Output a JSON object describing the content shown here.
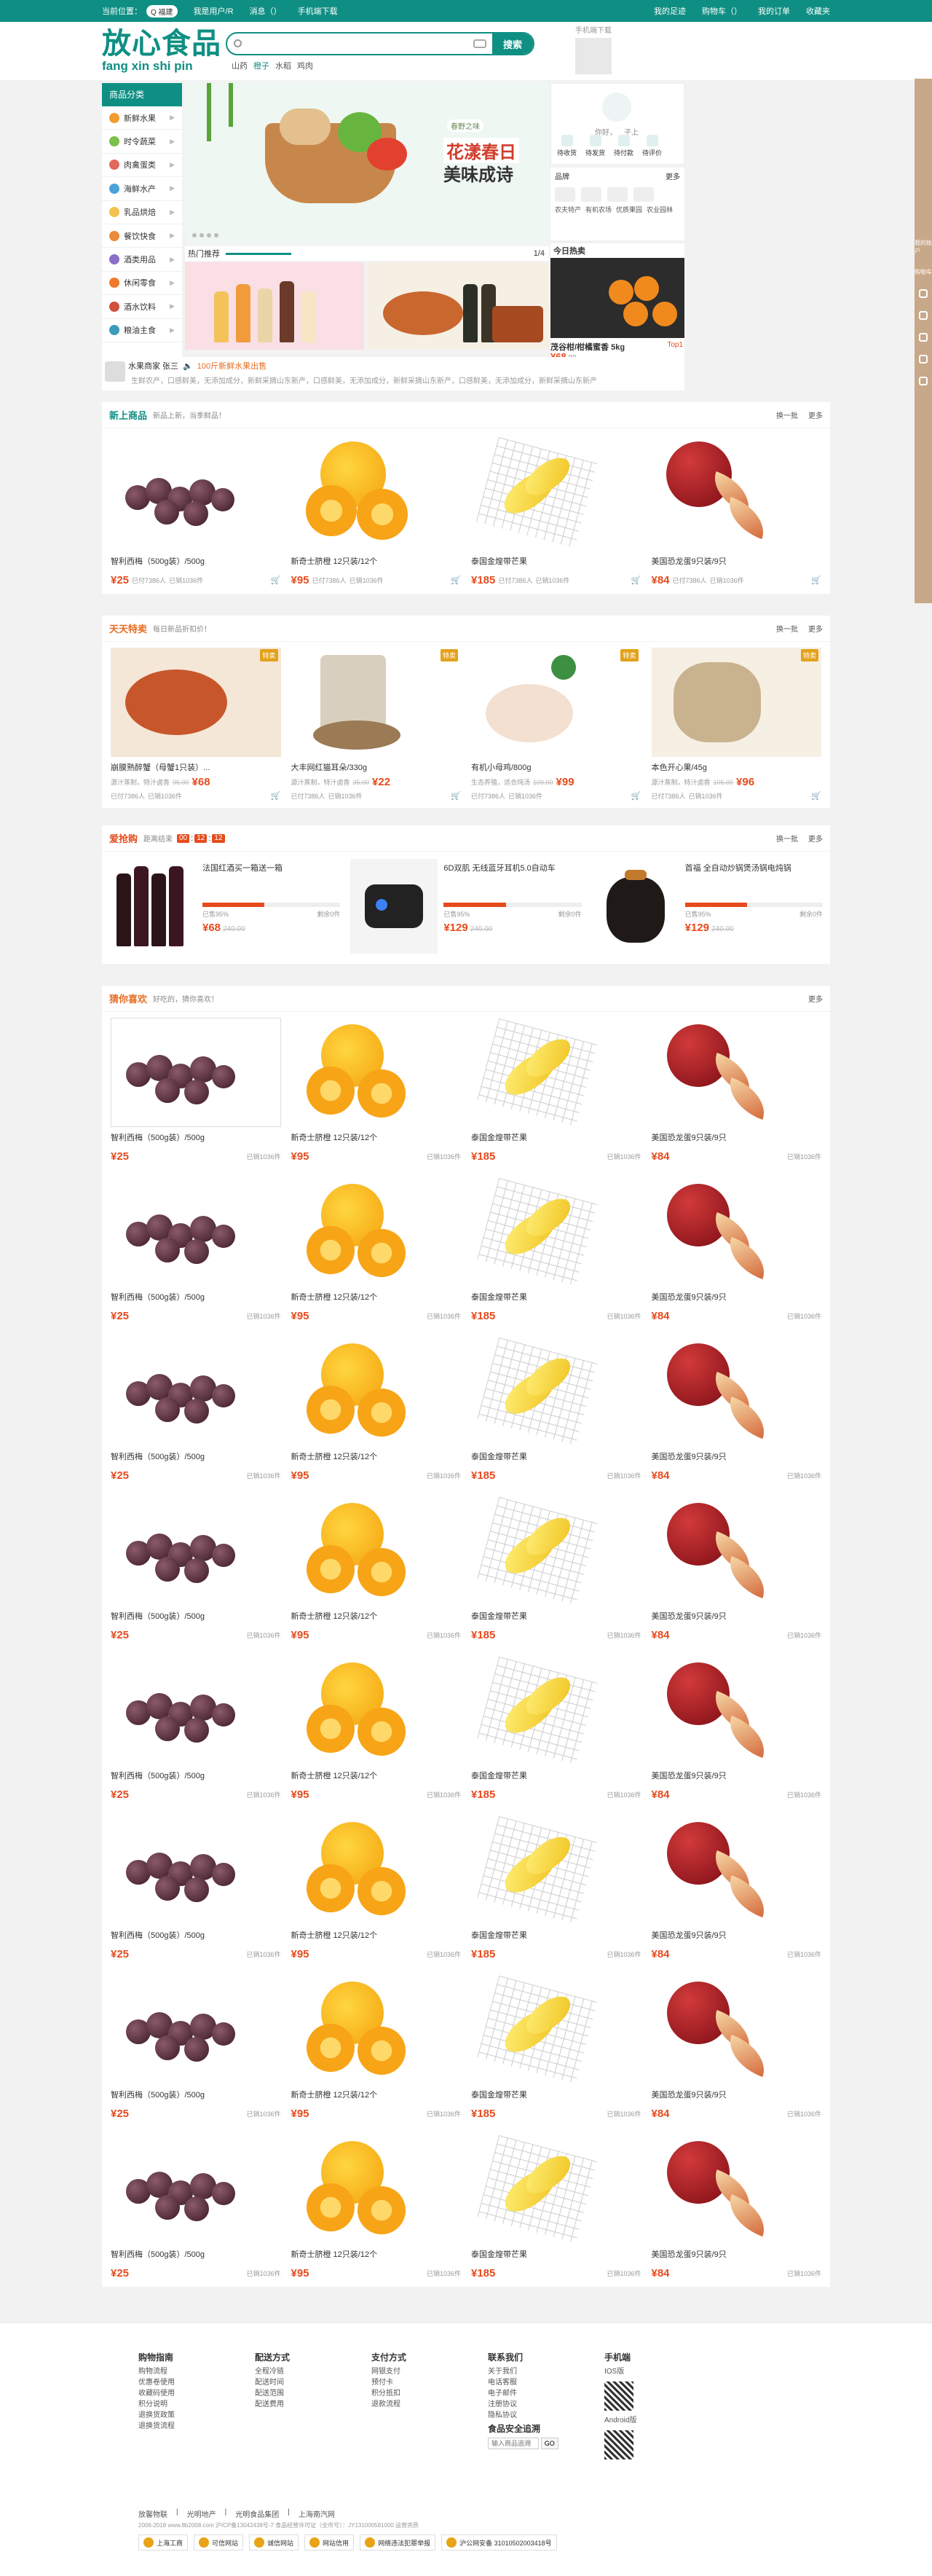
{
  "topbar": {
    "location_label": "当前位置：",
    "location_value": "Q 福建",
    "my_account": "我是用户/R",
    "messages": "消息（）",
    "mobile": "手机端下载",
    "links": [
      "我的足迹",
      "购物车（）",
      "我的订单",
      "收藏夹"
    ]
  },
  "header": {
    "logo_cn": "放心食品",
    "logo_py": "fang xin shi pin",
    "search_placeholder": "",
    "search_button": "搜索",
    "hot_words": [
      "山药",
      "橙子",
      "水稻",
      "鸡肉"
    ],
    "qr_label": "手机端下载"
  },
  "categories": {
    "title": "商品分类",
    "items": [
      "新鲜水果",
      "时令蔬菜",
      "肉禽蛋类",
      "海鲜水产",
      "乳品烘焙",
      "餐饮快食",
      "酒类用品",
      "休闲零食",
      "酒水饮料",
      "粮油主食"
    ]
  },
  "banner": {
    "tag": "春野之味",
    "line1": "花漾春日",
    "line2": "美味成诗"
  },
  "hot_recommend": {
    "label": "热门推荐",
    "page": "1/4"
  },
  "notice": {
    "title": "水果商家 张三",
    "highlight": "100斤新鲜水果出售",
    "desc": "生鲜农产，口感鲜美，无添加成分，新鲜采摘山东新产，口感鲜美，无添加成分，新鲜采摘山东新产，口感鲜美，无添加成分，新鲜采摘山东新产"
  },
  "user_box": {
    "hi": "你好， 子上",
    "ops": [
      "待收货",
      "待发货",
      "待付款",
      "待评价"
    ]
  },
  "brands": {
    "title": "品牌",
    "more": "更多",
    "labels": [
      "农夫特产",
      "有机农场",
      "优质果园",
      "农业园林"
    ]
  },
  "daily": {
    "title": "今日热卖",
    "caption": "茂谷柑/柑橘蜜香 5kg",
    "top": "Top1",
    "price": "¥68",
    "old": "88"
  },
  "new_goods": {
    "title": "新上商品",
    "sub": "新品上新，当季鲜品！",
    "change": "换一批",
    "more": "更多",
    "items": [
      {
        "name": "智利西梅（500g装）/500g",
        "price": "¥25",
        "sold": "已付7386人",
        "stock": "已销1036件"
      },
      {
        "name": "新奇士脐橙 12只装/12个",
        "price": "¥95",
        "sold": "已付7386人",
        "stock": "已销1036件"
      },
      {
        "name": "泰国金煌带芒果",
        "price": "¥185",
        "sold": "已付7386人",
        "stock": "已销1036件"
      },
      {
        "name": "美国恐龙蛋9只装/9只",
        "price": "¥84",
        "sold": "已付7386人",
        "stock": "已销1036件"
      }
    ]
  },
  "daily_deal": {
    "title": "天天特卖",
    "sub": "每日新品折扣价！",
    "change": "换一批",
    "more": "更多",
    "items": [
      {
        "name": "崩膜熟醉蟹（母蟹1只装）...",
        "desc": "源汁蒸制，特汁卤香",
        "price": "¥68",
        "old": "95.00",
        "sold": "已付7386人",
        "stock": "已销1036件",
        "badge": "特卖"
      },
      {
        "name": "大丰网红猫耳朵/330g",
        "desc": "源汁蒸制，特汁卤香",
        "price": "¥22",
        "old": "35.00",
        "sold": "已付7386人",
        "stock": "已销1036件",
        "badge": "特卖"
      },
      {
        "name": "有机小母鸡/800g",
        "desc": "生态养殖，适合炖汤",
        "price": "¥99",
        "old": "109.00",
        "sold": "已付7386人",
        "stock": "已销1036件",
        "badge": "特卖"
      },
      {
        "name": "本色开心果/45g",
        "desc": "源汁蒸制，特汁卤香",
        "price": "¥96",
        "old": "105.00",
        "sold": "已付7386人",
        "stock": "已销1036件",
        "badge": "特卖"
      }
    ]
  },
  "flash": {
    "title": "爱抢购",
    "sub": "距离结束",
    "countdown": [
      "00",
      "12",
      "12"
    ],
    "items": [
      {
        "name": "法国红酒买一箱送一箱",
        "price": "¥68",
        "old": "240.00",
        "sold": "已售95%",
        "left": "剩余0件"
      },
      {
        "name": "6D双肌 无线蓝牙耳机5.0自动车",
        "price": "¥129",
        "old": "240.00",
        "sold": "已售95%",
        "left": "剩余0件"
      },
      {
        "name": "首福 全自动炒锅煲汤锅电炖锅",
        "price": "¥129",
        "old": "240.00",
        "sold": "已售95%",
        "left": "剩余0件"
      }
    ]
  },
  "guess": {
    "title": "猜你喜欢",
    "sub": "好吃的，猜你喜欢！",
    "more": "更多",
    "items": [
      {
        "name": "智利西梅（500g装）/500g",
        "price": "¥25",
        "stock": "已销1036件"
      },
      {
        "name": "新奇士脐橙 12只装/12个",
        "price": "¥95",
        "stock": "已销1036件"
      },
      {
        "name": "泰国金煌带芒果",
        "price": "¥185",
        "stock": "已销1036件"
      },
      {
        "name": "美国恐龙蛋9只装/9只",
        "price": "¥84",
        "stock": "已销1036件"
      }
    ]
  },
  "footer": {
    "cols": [
      {
        "title": "购物指南",
        "items": [
          "购物流程",
          "优惠卷使用",
          "收藏码使用",
          "积分说明",
          "退换货政策",
          "退换货流程"
        ]
      },
      {
        "title": "配送方式",
        "items": [
          "全程冷链",
          "配送时间",
          "配送范围",
          "配送费用"
        ]
      },
      {
        "title": "支付方式",
        "items": [
          "网银支付",
          "预付卡",
          "积分抵扣",
          "退款流程"
        ]
      },
      {
        "title": "联系我们",
        "items": [
          "关于我们",
          "电话客服",
          "电子邮件",
          "注册协议",
          "隐私协议"
        ]
      }
    ],
    "safety": "食品安全追溯",
    "safety_placeholder": "输入商品追溯",
    "safety_btn": "GO",
    "mobile": "手机端",
    "ios": "IOS版",
    "android": "Android版",
    "links": [
      "放馨物联",
      "光明地产",
      "光明食品集团",
      "上海南汽网"
    ],
    "copyright": "2006-2018 www.8b2008.com 沪ICP备13042438号-7 食品经营许可证（全市号）：JY131000581000 运营资质",
    "badges": [
      "上海工商",
      "可信网站",
      "诚信网站",
      "网站信用",
      "网络违法犯罪举报",
      "沪公网安备 31010502003418号"
    ]
  },
  "float": {
    "labels": [
      "我的账户",
      "购物车"
    ]
  }
}
